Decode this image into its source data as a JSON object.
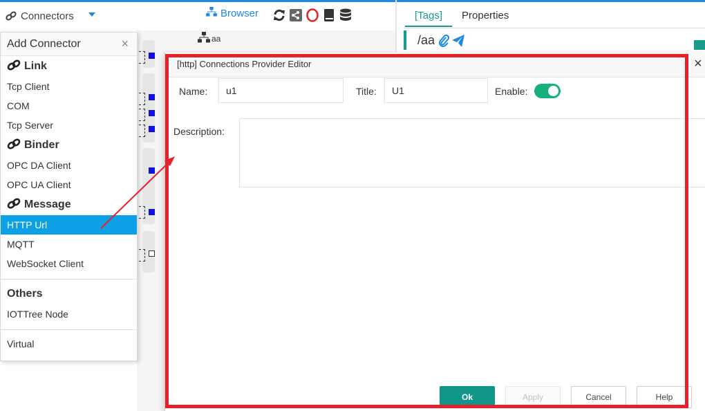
{
  "topbar": {
    "connectors_label": "Connectors",
    "browser_label": "Browser",
    "toolbar_icons": [
      "refresh-icon",
      "share-icon",
      "ring-icon",
      "book-icon",
      "database-icon"
    ]
  },
  "tree": {
    "node_label": "aa"
  },
  "right_panel": {
    "tabs": [
      {
        "label": "[Tags]",
        "active": true
      },
      {
        "label": "Properties",
        "active": false
      }
    ],
    "path": "/aa"
  },
  "add_connector_menu": {
    "title": "Add Connector",
    "close_glyph": "×",
    "groups": [
      {
        "label": "Link",
        "items": [
          "Tcp Client",
          "COM",
          "Tcp Server"
        ]
      },
      {
        "label": "Binder",
        "items": [
          "OPC DA Client",
          "OPC UA Client"
        ]
      },
      {
        "label": "Message",
        "items": [
          "HTTP Url",
          "MQTT",
          "WebSocket Client"
        ]
      }
    ],
    "others_label": "Others",
    "others_items": [
      "IOTTree Node"
    ],
    "virtual_label": "Virtual",
    "selected_item": "HTTP Url"
  },
  "dialog": {
    "title": "[http] Connections Provider Editor",
    "close_glyph": "×",
    "name_label": "Name:",
    "name_value": "u1",
    "title_label": "Title:",
    "title_value": "U1",
    "enable_label": "Enable:",
    "enabled": true,
    "description_label": "Description:",
    "description_value": "",
    "buttons": {
      "ok": "Ok",
      "apply": "Apply",
      "cancel": "Cancel",
      "help": "Help"
    }
  },
  "colors": {
    "accent_blue": "#1e88e5",
    "teal": "#0f9688",
    "selected_bg": "#0ea0e6",
    "toggle_on": "#16b07c",
    "annotation_red": "#e8202a"
  }
}
